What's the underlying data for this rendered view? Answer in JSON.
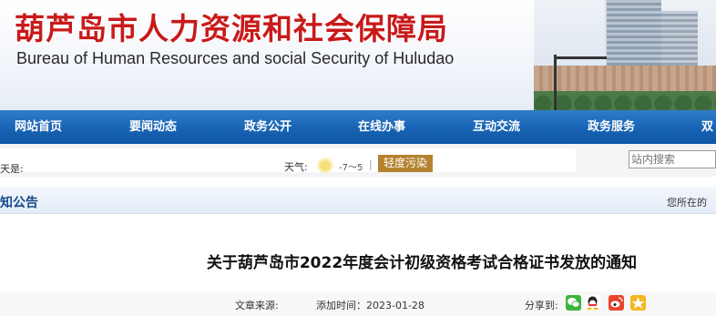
{
  "header": {
    "title_cn": "葫芦岛市人力资源和社会保障局",
    "title_en": "Bureau of Human Resources and social Security of Huludao"
  },
  "nav": {
    "items": [
      "网站首页",
      "要闻动态",
      "政务公开",
      "在线办事",
      "互动交流",
      "政务服务",
      "双"
    ]
  },
  "infobar": {
    "date_label": "天是:",
    "weather_label": "天气:",
    "weather_icon": "sun-icon",
    "temperature": "-7～5",
    "separator": "|",
    "air_quality": "轻度污染",
    "search_placeholder": "站内搜索"
  },
  "column": {
    "title": "知公告",
    "breadcrumb": "您所在的"
  },
  "article": {
    "title": "关于葫芦岛市2022年度会计初级资格考试合格证书发放的通知",
    "source_label": "文章来源:",
    "added_time": "添加时间：2023-01-28",
    "share_label": "分享到:",
    "share_icons": [
      "wechat-icon",
      "qq-icon",
      "weibo-icon",
      "qzone-icon"
    ]
  },
  "colors": {
    "title_red": "#c81a1a",
    "nav_blue": "#1863b4",
    "column_title_blue": "#17498b",
    "aqi_badge": "#b5822f"
  }
}
